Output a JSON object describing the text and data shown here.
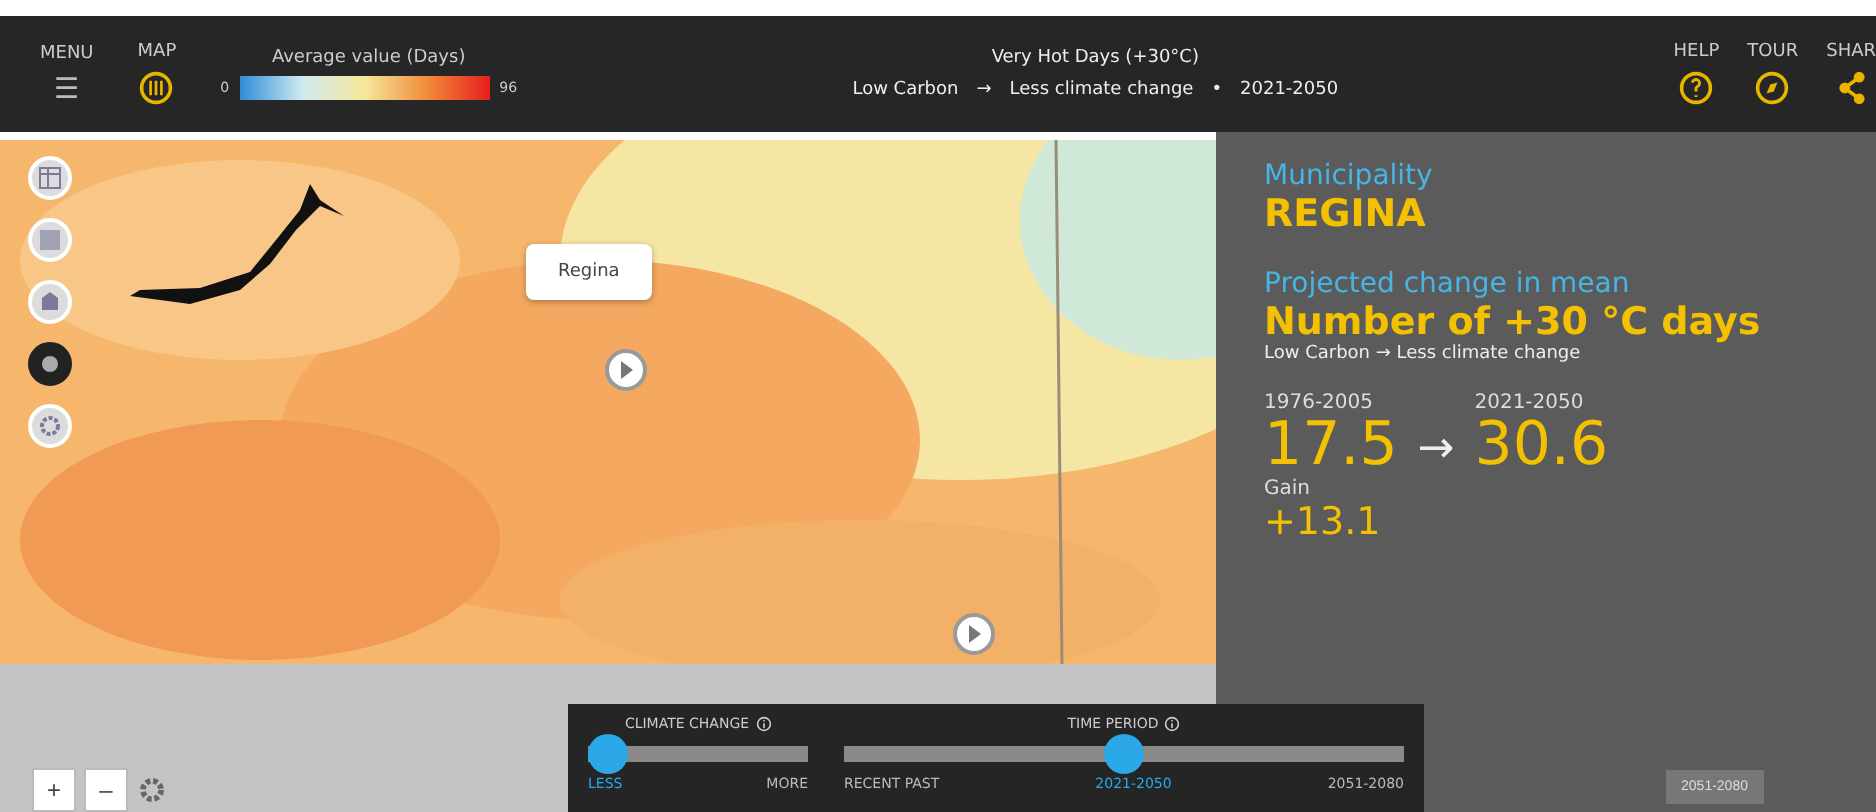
{
  "topbar": {
    "menu": {
      "label": "MENU",
      "icon": "☰"
    },
    "map": {
      "label": "MAP"
    },
    "legend": {
      "title": "Average value (Days)",
      "min": "0",
      "max": "96"
    },
    "title": "Very Hot Days (+30°C)",
    "subtitle": [
      "Low Carbon",
      "→",
      "Less climate change",
      "•",
      "2021-2050"
    ],
    "actions": [
      {
        "label": "HELP",
        "kind": "help"
      },
      {
        "label": "TOUR",
        "kind": "tour"
      },
      {
        "label": "SHAR",
        "kind": "share"
      }
    ]
  },
  "map": {
    "tools": [
      {
        "kind": "grid",
        "selected": false
      },
      {
        "kind": "layers",
        "selected": false
      },
      {
        "kind": "region",
        "selected": false
      },
      {
        "kind": "dot",
        "selected": true
      },
      {
        "kind": "gear",
        "selected": false
      }
    ],
    "tooltip": "Regina",
    "zoom": [
      "+",
      "–"
    ]
  },
  "panel": {
    "place_label": "Municipality",
    "place": "REGINA",
    "metric_label": "Projected change in mean",
    "metric": "Number of +30 °C days",
    "scenario": "Low Carbon → Less climate change",
    "from_period": "1976-2005",
    "from_value": "17.5",
    "arrow": "→",
    "to_period": "2021-2050",
    "to_value": "30.6",
    "gain_label": "Gain",
    "gain": "+13.1",
    "next_button": "2051-2080"
  },
  "controls": {
    "sliders": [
      {
        "title": "CLIMATE CHANGE",
        "level": 0,
        "ticks": [
          {
            "label": "LESS",
            "selected": true
          },
          {
            "label": "MORE",
            "selected": false
          }
        ]
      },
      {
        "title": "TIME PERIOD",
        "level": 0.5,
        "ticks": [
          {
            "label": "RECENT PAST",
            "selected": false
          },
          {
            "label": "2021-2050",
            "selected": true
          },
          {
            "label": "2051-2080",
            "selected": false
          }
        ]
      }
    ]
  }
}
